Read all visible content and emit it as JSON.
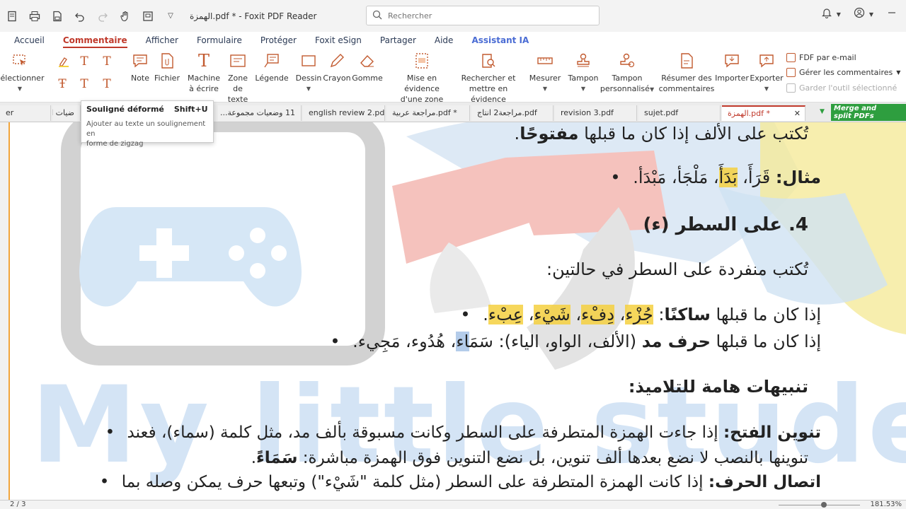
{
  "app": {
    "doc_title": "الهمزة.pdf * - Foxit PDF Reader",
    "search_placeholder": "Rechercher"
  },
  "ribbon_tabs": [
    {
      "label": "Accueil"
    },
    {
      "label": "Commentaire"
    },
    {
      "label": "Afficher"
    },
    {
      "label": "Formulaire"
    },
    {
      "label": "Protéger"
    },
    {
      "label": "Foxit eSign"
    },
    {
      "label": "Partager"
    },
    {
      "label": "Aide"
    },
    {
      "label": "Assistant IA"
    }
  ],
  "tools": {
    "selectionner": "Sélectionner",
    "note": "Note",
    "fichier": "Fichier",
    "machine_1": "Machine",
    "machine_2": "à écrire",
    "zone_texte_1": "Zone",
    "zone_texte_2": "de texte",
    "legende": "Légende",
    "dessin": "Dessin",
    "crayon": "Crayon",
    "gomme": "Gomme",
    "mise_1": "Mise en évidence",
    "mise_2": "d'une zone",
    "rechercher_1": "Rechercher et",
    "rechercher_2": "mettre en évidence",
    "mesurer": "Mesurer",
    "tampon": "Tampon",
    "tampon_perso_1": "Tampon",
    "tampon_perso_2": "personnalisé",
    "resumer_1": "Résumer des",
    "resumer_2": "commentaires",
    "importer": "Importer",
    "exporter": "Exporter",
    "fdf_email": "FDF par e-mail",
    "gerer": "Gérer les commentaires",
    "garder": "Garder l'outil sélectionné"
  },
  "doc_tabs": [
    {
      "label": "er"
    },
    {
      "label": "ضيات ا"
    },
    {
      "label": "11 وضعيات مجموعة..."
    },
    {
      "label": "english review 2.pdf *"
    },
    {
      "label": "مراجعة عربية.pdf *"
    },
    {
      "label": "مراجعة2 انتاج.pdf"
    },
    {
      "label": "revision 3.pdf"
    },
    {
      "label": "sujet.pdf"
    },
    {
      "label": "الهمزة.pdf *"
    }
  ],
  "merge_badge": {
    "line1": "Merge and",
    "line2": "split PDFs"
  },
  "tooltip": {
    "title": "Souligné déformé",
    "shortcut": "Shift+U",
    "description_1": "Ajouter au texte un soulignement en",
    "description_2": "forme de zigzag"
  },
  "content": {
    "line1_a": "تُكتب على الألف إذا كان ما قبلها ",
    "line1_b": "مفتوحًا",
    "line1_c": ".",
    "ex_label": "مثال:",
    "ex_words": [
      " قَرَأَ",
      "، ",
      "بَدَأَ",
      "، ",
      "مَلْجَأ",
      "، ",
      "مَبْدَأ",
      "."
    ],
    "heading4": "4. على السطر (ء)",
    "line3": "تُكتب منفردة على السطر في حالتين:",
    "case1_a": "إذا كان ما قبلها ",
    "case1_b": "ساكنًا",
    "case1_c": ": ",
    "case1_words": [
      "جُزْء",
      "، ",
      "دِفْء",
      "، ",
      "شَيْء",
      "، ",
      "عِبْء",
      "."
    ],
    "case2_a": "إذا كان ما قبلها ",
    "case2_b": "حرف مد",
    "case2_c": " (الألف، الواو، الياء): ",
    "case2_d": "سَمَ",
    "case2_e": "اء",
    "case2_f": "، هُدُوء، مَجِيء.",
    "notes_heading": "تنبيهات هامة للتلاميذ:",
    "note1_b": "تنوين الفتح:",
    "note1_a": " إذا جاءت الهمزة المتطرفة على السطر وكانت مسبوقة بألف مد، مثل كلمة (سماء)، فعند",
    "note1_line2_a": "تنوينها بالنصب لا نضع بعدها ألف تنوين، بل نضع التنوين فوق الهمزة مباشرة: ",
    "note1_line2_b": "سَمَاءً",
    "note1_line2_c": ".",
    "note2_b": "اتصال الحرف:",
    "note2_a": " إذا كانت الهمزة المتطرفة على السطر (مثل كلمة \"شَيْء\") وتبعها حرف يمكن وصله بما"
  },
  "watermark": "My little student",
  "status": {
    "page": "2 / 3",
    "zoom": "181.53%"
  },
  "colors": {
    "accent": "#c0392b",
    "tool_icon": "#c25a2f",
    "highlight": "#f4d03f",
    "merge_badge": "#2e9e3f"
  }
}
